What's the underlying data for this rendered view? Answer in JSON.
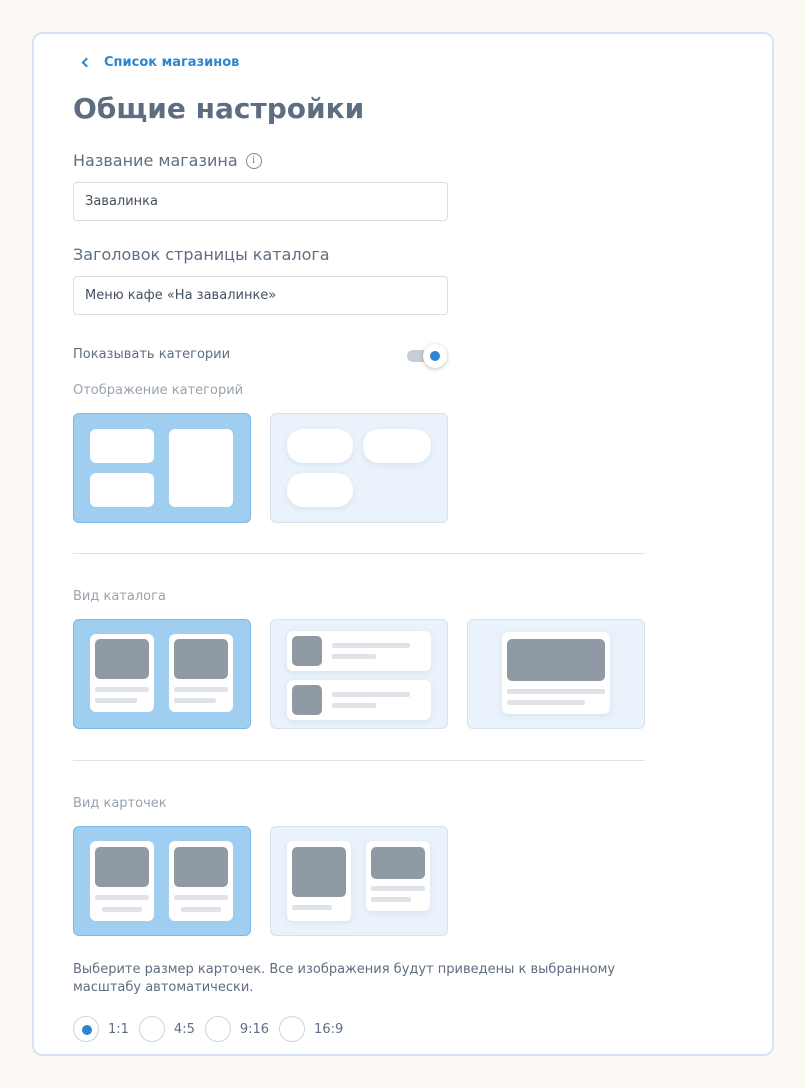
{
  "header": {
    "back_label": "Список магазинов",
    "title": "Общие настройки"
  },
  "store_name": {
    "label": "Название магазина",
    "info_icon": "info-icon",
    "value": "Завалинка"
  },
  "catalog_title": {
    "label": "Заголовок страницы каталога",
    "value": "Меню кафе «На завалинке»"
  },
  "show_categories": {
    "label": "Показывать категории",
    "enabled": true
  },
  "category_display": {
    "label": "Отображение категорий",
    "selected": 0,
    "options": [
      "tiles",
      "pills"
    ]
  },
  "catalog_view": {
    "label": "Вид каталога",
    "selected": 0,
    "options": [
      "grid",
      "list",
      "large"
    ]
  },
  "card_view": {
    "label": "Вид карточек",
    "selected": 0,
    "options": [
      "equal",
      "mixed"
    ]
  },
  "card_size": {
    "description": "Выберите размер карточек. Все изображения будут приведены к выбранному масштабу автоматически.",
    "selected": "1:1",
    "options": [
      "1:1",
      "4:5",
      "9:16",
      "16:9"
    ]
  },
  "colors": {
    "accent": "#2b86cf",
    "selected_bg": "#9fcef0",
    "unselected_bg": "#eaf3fb",
    "page_bg": "#fcf9f4"
  }
}
